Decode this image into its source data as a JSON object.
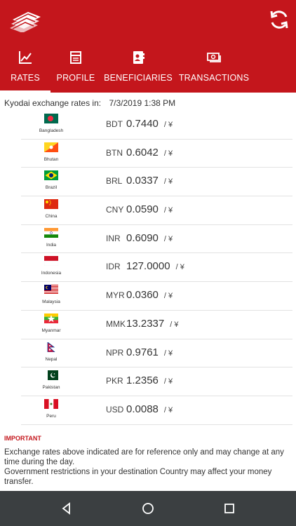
{
  "app": {
    "logo_icon": "kyodai-logo",
    "refresh_icon": "refresh-icon",
    "brand_color": "#c4161c"
  },
  "tabs": [
    {
      "label": "RATES",
      "icon": "chart-icon",
      "active": true
    },
    {
      "label": "PROFILE",
      "icon": "calendar-icon",
      "active": false
    },
    {
      "label": "BENEFICIARIES",
      "icon": "contacts-icon",
      "active": false
    },
    {
      "label": "TRANSACTIONS",
      "icon": "money-icon",
      "active": false
    }
  ],
  "rates_header": {
    "label": "Kyodai exchange rates in:",
    "date": "7/3/2019 1:38 PM"
  },
  "rates": [
    {
      "country": "Bangladesh",
      "code": "BDT",
      "rate": "0.7440",
      "unit": "/ ¥"
    },
    {
      "country": "Bhutan",
      "code": "BTN",
      "rate": "0.6042",
      "unit": "/ ¥"
    },
    {
      "country": "Brazil",
      "code": "BRL",
      "rate": "0.0337",
      "unit": "/ ¥"
    },
    {
      "country": "China",
      "code": "CNY",
      "rate": "0.0590",
      "unit": "/ ¥"
    },
    {
      "country": "India",
      "code": "INR",
      "rate": "0.6090",
      "unit": "/ ¥"
    },
    {
      "country": "Indonesia",
      "code": "IDR",
      "rate": "127.0000",
      "unit": "/ ¥"
    },
    {
      "country": "Malaysia",
      "code": "MYR",
      "rate": "0.0360",
      "unit": "/ ¥"
    },
    {
      "country": "Myanmar",
      "code": "MMK",
      "rate": "13.2337",
      "unit": "/ ¥"
    },
    {
      "country": "Nepal",
      "code": "NPR",
      "rate": "0.9761",
      "unit": "/ ¥"
    },
    {
      "country": "Pakistan",
      "code": "PKR",
      "rate": "1.2356",
      "unit": "/ ¥"
    },
    {
      "country": "Peru",
      "code": "USD",
      "rate": "0.0088",
      "unit": "/ ¥"
    }
  ],
  "notice": {
    "title": "IMPORTANT",
    "line1": "Exchange rates above indicated are for reference only and may change at any time during the day.",
    "line2": "Government restrictions in your destination Country may affect your money transfer."
  },
  "system_nav": {
    "back_icon": "back-icon",
    "home_icon": "home-icon",
    "recents_icon": "recents-icon"
  }
}
